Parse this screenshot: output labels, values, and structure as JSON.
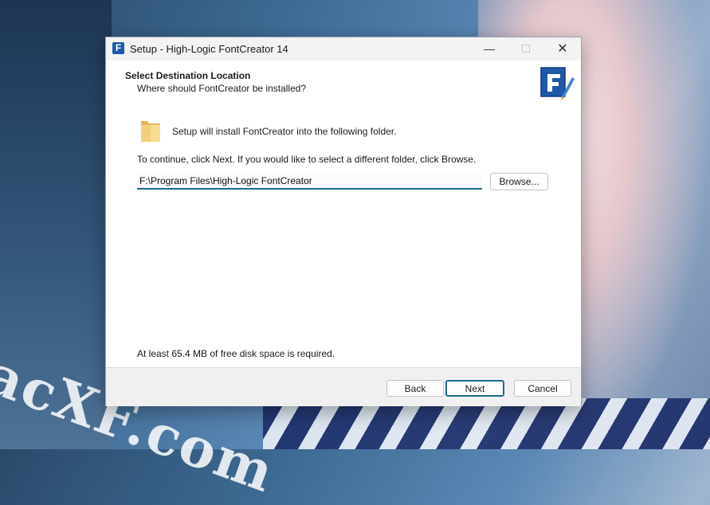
{
  "background": {
    "watermark_text": "acXF.com"
  },
  "window": {
    "title": "Setup - High-Logic FontCreator 14",
    "controls": {
      "minimize": "—",
      "maximize": "☐",
      "close": "✕"
    }
  },
  "header": {
    "title": "Select Destination Location",
    "subtitle": "Where should FontCreator be installed?"
  },
  "body": {
    "setup_text": "Setup will install FontCreator into the following folder.",
    "continue_text": "To continue, click Next. If you would like to select a different folder, click Browse.",
    "path_value": "F:\\Program Files\\High-Logic FontCreator",
    "browse_label": "Browse...",
    "disk_text": "At least 65.4 MB of free disk space is required."
  },
  "footer": {
    "back_label": "Back",
    "next_label": "Next",
    "cancel_label": "Cancel"
  },
  "colors": {
    "accent": "#1a6d8a",
    "logo_blue": "#1e5aa8"
  }
}
